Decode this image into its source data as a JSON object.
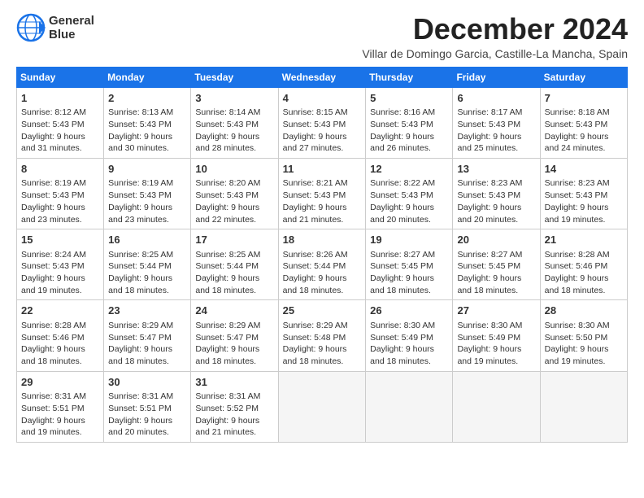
{
  "logo": {
    "line1": "General",
    "line2": "Blue"
  },
  "title": "December 2024",
  "subtitle": "Villar de Domingo Garcia, Castille-La Mancha, Spain",
  "weekdays": [
    "Sunday",
    "Monday",
    "Tuesday",
    "Wednesday",
    "Thursday",
    "Friday",
    "Saturday"
  ],
  "weeks": [
    [
      {
        "day": "1",
        "info": "Sunrise: 8:12 AM\nSunset: 5:43 PM\nDaylight: 9 hours\nand 31 minutes."
      },
      {
        "day": "2",
        "info": "Sunrise: 8:13 AM\nSunset: 5:43 PM\nDaylight: 9 hours\nand 30 minutes."
      },
      {
        "day": "3",
        "info": "Sunrise: 8:14 AM\nSunset: 5:43 PM\nDaylight: 9 hours\nand 28 minutes."
      },
      {
        "day": "4",
        "info": "Sunrise: 8:15 AM\nSunset: 5:43 PM\nDaylight: 9 hours\nand 27 minutes."
      },
      {
        "day": "5",
        "info": "Sunrise: 8:16 AM\nSunset: 5:43 PM\nDaylight: 9 hours\nand 26 minutes."
      },
      {
        "day": "6",
        "info": "Sunrise: 8:17 AM\nSunset: 5:43 PM\nDaylight: 9 hours\nand 25 minutes."
      },
      {
        "day": "7",
        "info": "Sunrise: 8:18 AM\nSunset: 5:43 PM\nDaylight: 9 hours\nand 24 minutes."
      }
    ],
    [
      {
        "day": "8",
        "info": "Sunrise: 8:19 AM\nSunset: 5:43 PM\nDaylight: 9 hours\nand 23 minutes."
      },
      {
        "day": "9",
        "info": "Sunrise: 8:19 AM\nSunset: 5:43 PM\nDaylight: 9 hours\nand 23 minutes."
      },
      {
        "day": "10",
        "info": "Sunrise: 8:20 AM\nSunset: 5:43 PM\nDaylight: 9 hours\nand 22 minutes."
      },
      {
        "day": "11",
        "info": "Sunrise: 8:21 AM\nSunset: 5:43 PM\nDaylight: 9 hours\nand 21 minutes."
      },
      {
        "day": "12",
        "info": "Sunrise: 8:22 AM\nSunset: 5:43 PM\nDaylight: 9 hours\nand 20 minutes."
      },
      {
        "day": "13",
        "info": "Sunrise: 8:23 AM\nSunset: 5:43 PM\nDaylight: 9 hours\nand 20 minutes."
      },
      {
        "day": "14",
        "info": "Sunrise: 8:23 AM\nSunset: 5:43 PM\nDaylight: 9 hours\nand 19 minutes."
      }
    ],
    [
      {
        "day": "15",
        "info": "Sunrise: 8:24 AM\nSunset: 5:43 PM\nDaylight: 9 hours\nand 19 minutes."
      },
      {
        "day": "16",
        "info": "Sunrise: 8:25 AM\nSunset: 5:44 PM\nDaylight: 9 hours\nand 18 minutes."
      },
      {
        "day": "17",
        "info": "Sunrise: 8:25 AM\nSunset: 5:44 PM\nDaylight: 9 hours\nand 18 minutes."
      },
      {
        "day": "18",
        "info": "Sunrise: 8:26 AM\nSunset: 5:44 PM\nDaylight: 9 hours\nand 18 minutes."
      },
      {
        "day": "19",
        "info": "Sunrise: 8:27 AM\nSunset: 5:45 PM\nDaylight: 9 hours\nand 18 minutes."
      },
      {
        "day": "20",
        "info": "Sunrise: 8:27 AM\nSunset: 5:45 PM\nDaylight: 9 hours\nand 18 minutes."
      },
      {
        "day": "21",
        "info": "Sunrise: 8:28 AM\nSunset: 5:46 PM\nDaylight: 9 hours\nand 18 minutes."
      }
    ],
    [
      {
        "day": "22",
        "info": "Sunrise: 8:28 AM\nSunset: 5:46 PM\nDaylight: 9 hours\nand 18 minutes."
      },
      {
        "day": "23",
        "info": "Sunrise: 8:29 AM\nSunset: 5:47 PM\nDaylight: 9 hours\nand 18 minutes."
      },
      {
        "day": "24",
        "info": "Sunrise: 8:29 AM\nSunset: 5:47 PM\nDaylight: 9 hours\nand 18 minutes."
      },
      {
        "day": "25",
        "info": "Sunrise: 8:29 AM\nSunset: 5:48 PM\nDaylight: 9 hours\nand 18 minutes."
      },
      {
        "day": "26",
        "info": "Sunrise: 8:30 AM\nSunset: 5:49 PM\nDaylight: 9 hours\nand 18 minutes."
      },
      {
        "day": "27",
        "info": "Sunrise: 8:30 AM\nSunset: 5:49 PM\nDaylight: 9 hours\nand 19 minutes."
      },
      {
        "day": "28",
        "info": "Sunrise: 8:30 AM\nSunset: 5:50 PM\nDaylight: 9 hours\nand 19 minutes."
      }
    ],
    [
      {
        "day": "29",
        "info": "Sunrise: 8:31 AM\nSunset: 5:51 PM\nDaylight: 9 hours\nand 19 minutes."
      },
      {
        "day": "30",
        "info": "Sunrise: 8:31 AM\nSunset: 5:51 PM\nDaylight: 9 hours\nand 20 minutes."
      },
      {
        "day": "31",
        "info": "Sunrise: 8:31 AM\nSunset: 5:52 PM\nDaylight: 9 hours\nand 21 minutes."
      },
      {
        "day": "",
        "info": ""
      },
      {
        "day": "",
        "info": ""
      },
      {
        "day": "",
        "info": ""
      },
      {
        "day": "",
        "info": ""
      }
    ]
  ]
}
